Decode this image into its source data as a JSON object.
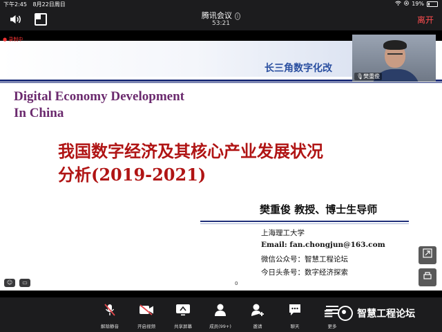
{
  "status_bar": {
    "time": "下午2:45",
    "date": "8月22日周日",
    "battery": "19%",
    "battery_level": 0.19
  },
  "meeting": {
    "title": "腾讯会议",
    "elapsed": "53:21",
    "leave_label": "离开",
    "recording_label": "录制中"
  },
  "slide": {
    "banner": "长三角数字化改",
    "title_en_line1": "Digital Economy Development",
    "title_en_line2": "In China",
    "title_cn_line1": "我国数字经济及其核心产业发展状况",
    "title_cn_line2": "分析(2019-2021)",
    "author": "樊重俊 教授、博士生导师",
    "affiliation": "上海理工大学",
    "email": "Email: fan.chongjun@163.com",
    "wechat": "微信公众号：智慧工程论坛",
    "toutiao": "今日头条号：数字经济探索",
    "page_number": "0"
  },
  "camera": {
    "participant_name": "樊重俊"
  },
  "toolbar": [
    {
      "label": "解除静音",
      "icon": "muted-mic-icon"
    },
    {
      "label": "开启视频",
      "icon": "video-off-icon"
    },
    {
      "label": "共享屏幕",
      "icon": "share-screen-icon"
    },
    {
      "label": "成员(99+)",
      "icon": "members-icon"
    },
    {
      "label": "邀请",
      "icon": "invite-icon"
    },
    {
      "label": "聊天",
      "icon": "chat-icon"
    },
    {
      "label": "更多",
      "icon": "more-icon"
    }
  ],
  "watermark": "智慧工程论坛",
  "colors": {
    "leave": "#ff4d4f",
    "slide_title_en": "#6b2a6e",
    "slide_title_cn": "#b01414",
    "banner_text": "#2a4fa0",
    "rule": "#1f2f7a",
    "muted_red": "#e5484d"
  }
}
